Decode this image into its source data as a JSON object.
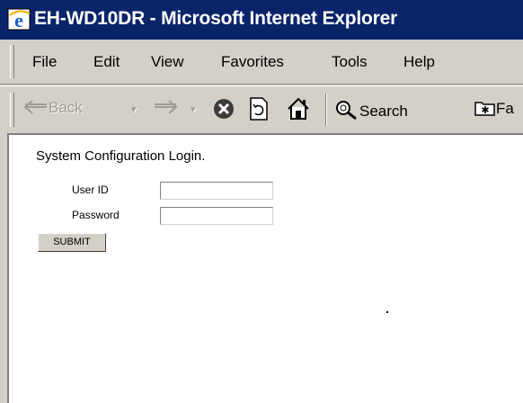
{
  "window": {
    "title": "EH-WD10DR - Microsoft Internet Explorer"
  },
  "menu": {
    "items": [
      "File",
      "Edit",
      "View",
      "Favorites",
      "Tools",
      "Help"
    ]
  },
  "toolbar": {
    "back_label": "Back",
    "search_label": "Search",
    "favorites_label": "Fa"
  },
  "page": {
    "heading": "System Configuration Login.",
    "user_id_label": "User ID",
    "password_label": "Password",
    "user_id_value": "",
    "password_value": "",
    "submit_label": "SUBMIT"
  }
}
